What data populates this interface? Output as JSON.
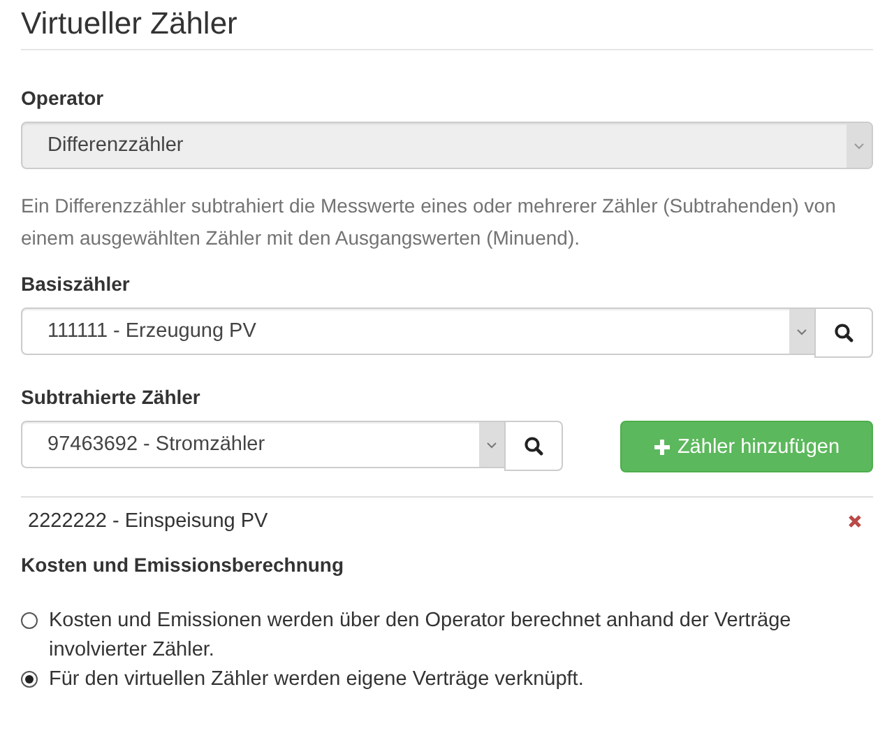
{
  "title": "Virtueller Zähler",
  "operator": {
    "label": "Operator",
    "value": "Differenzzähler",
    "disabled": true
  },
  "help_text": "Ein Differenzzähler subtrahiert die Messwerte eines oder mehrerer Zähler (Subtrahenden) von einem ausgewählten Zähler mit den Ausgangswerten (Minuend).",
  "base_meter": {
    "label": "Basiszähler",
    "value": "111111 - Erzeugung PV",
    "disabled": false
  },
  "subtracted": {
    "label": "Subtrahierte Zähler",
    "value": "97463692 - Stromzähler",
    "disabled": false,
    "add_button": "Zähler hinzufügen",
    "items": [
      {
        "name": "2222222 - Einspeisung PV"
      }
    ]
  },
  "costs": {
    "heading": "Kosten und Emissionsberechnung",
    "options": [
      {
        "label": "Kosten und Emissionen werden über den Operator berechnet anhand der Verträge involvierter Zähler.",
        "selected": false
      },
      {
        "label": "Für den virtuellen Zähler werden eigene Verträge verknüpft.",
        "selected": true
      }
    ]
  }
}
